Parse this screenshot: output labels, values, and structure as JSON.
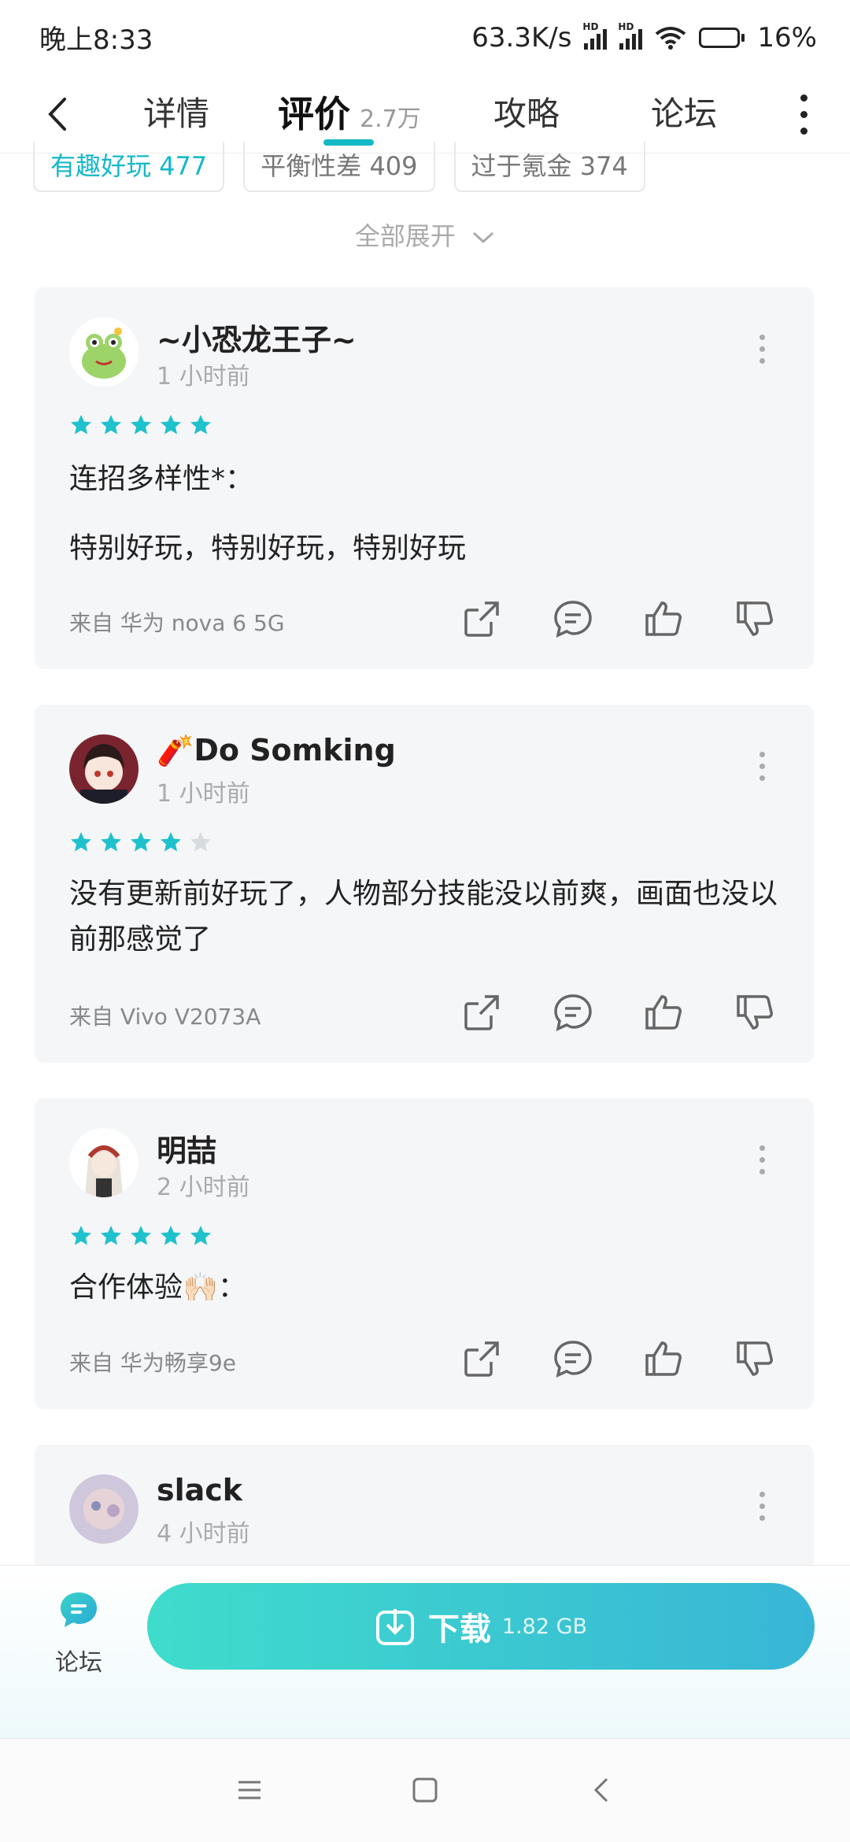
{
  "status_bar": {
    "time": "晚上8:33",
    "net_speed": "63.3K/s",
    "hd_label": "HD",
    "battery": "16%"
  },
  "nav": {
    "tabs": [
      {
        "label": "详情"
      },
      {
        "label": "评价",
        "sub": "2.7万"
      },
      {
        "label": "攻略"
      },
      {
        "label": "论坛"
      }
    ],
    "active_tab": 1
  },
  "tags": [
    {
      "label": "有趣好玩 477"
    },
    {
      "label": "平衡性差 409"
    },
    {
      "label": "过于氪金 374"
    }
  ],
  "expand_label": "全部展开",
  "reviews": [
    {
      "user": "~小恐龙王子~",
      "time": "1 小时前",
      "rating": 5,
      "lines": [
        "连招多样性*：",
        "特别好玩，特别好玩，特别好玩"
      ],
      "device": "来自 华为 nova 6 5G"
    },
    {
      "user": "🧨Do Somking",
      "time": "1 小时前",
      "rating": 4,
      "lines": [
        "没有更新前好玩了，人物部分技能没以前爽，画面也没以前那感觉了"
      ],
      "device": "来自 Vivo V2073A"
    },
    {
      "user": "明喆",
      "time": "2 小时前",
      "rating": 5,
      "lines": [
        "合作体验🙌🏻："
      ],
      "device": "来自 华为畅享9e"
    },
    {
      "user": "slack",
      "time": "4 小时前"
    }
  ],
  "bottom_bar": {
    "forum_label": "论坛",
    "download_label": "下载",
    "download_size": "1.82 GB"
  },
  "colors": {
    "accent": "#14b9c8",
    "star": "#1fc1cc",
    "star_empty": "#d8dcdf"
  }
}
